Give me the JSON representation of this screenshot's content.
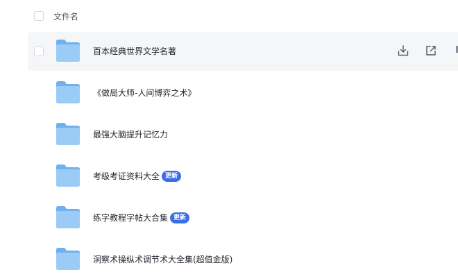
{
  "header": {
    "column_label": "文件名"
  },
  "files": [
    {
      "name": "百本经典世界文学名著",
      "badge": "",
      "hovered": true
    },
    {
      "name": "《做局大师-人间博弈之术》",
      "badge": ""
    },
    {
      "name": "最强大脑提升记忆力",
      "badge": ""
    },
    {
      "name": "考级考证资料大全",
      "badge": "更新"
    },
    {
      "name": "练字教程字帖大合集",
      "badge": "更新"
    },
    {
      "name": "洞察术操纵术调节术大全集(超值金版)",
      "badge": ""
    }
  ],
  "icons": {
    "folder": "folder-icon",
    "download": "download-icon",
    "share": "share-icon"
  },
  "colors": {
    "folder": "#8cc3f5",
    "badge": "#3a6ee8",
    "hover_row": "#f5f6f7"
  }
}
